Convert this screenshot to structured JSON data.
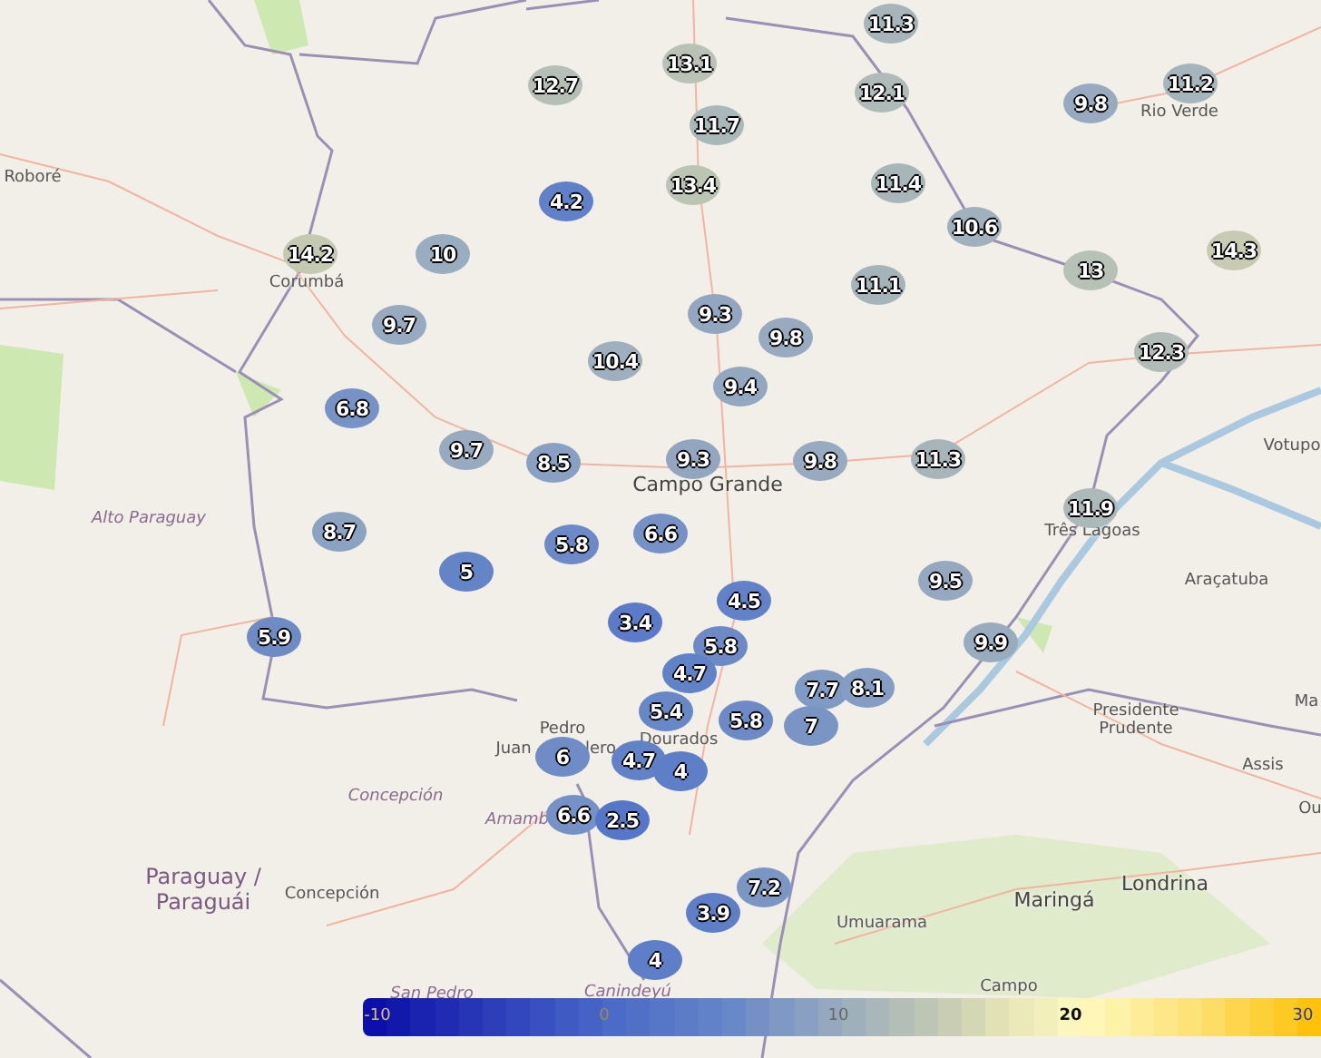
{
  "map_labels": [
    {
      "text": "Roboré",
      "kind": "town"
    },
    {
      "text": "Corumbá",
      "kind": "town"
    },
    {
      "text": "Alto Paraguay",
      "kind": "region"
    },
    {
      "text": "Campo Grande",
      "kind": "city"
    },
    {
      "text": "Rio Verde",
      "kind": "town"
    },
    {
      "text": "Votupo",
      "kind": "town"
    },
    {
      "text": "Três Lagoas",
      "kind": "town"
    },
    {
      "text": "Araçatuba",
      "kind": "town"
    },
    {
      "text": "Presidente",
      "kind": "town"
    },
    {
      "text": "Prudente",
      "kind": "town"
    },
    {
      "text": "Ma",
      "kind": "town"
    },
    {
      "text": "Assis",
      "kind": "town"
    },
    {
      "text": "Ou",
      "kind": "town"
    },
    {
      "text": "Londrina",
      "kind": "city"
    },
    {
      "text": "Maringá",
      "kind": "city"
    },
    {
      "text": "Umuarama",
      "kind": "town"
    },
    {
      "text": "Campo",
      "kind": "town"
    },
    {
      "text": "Pedro",
      "kind": "town"
    },
    {
      "text": "Juan",
      "kind": "town"
    },
    {
      "text": "lero",
      "kind": "town"
    },
    {
      "text": "Dourados",
      "kind": "town"
    },
    {
      "text": "Concepción",
      "kind": "region"
    },
    {
      "text": "Amamb",
      "kind": "region"
    },
    {
      "text": "Paraguay /",
      "kind": "country"
    },
    {
      "text": "Paraguái",
      "kind": "country"
    },
    {
      "text": "Concepción",
      "kind": "town"
    },
    {
      "text": "San Pedro",
      "kind": "region"
    },
    {
      "text": "Canindeyú",
      "kind": "region"
    }
  ],
  "markers": [
    {
      "value": "12.7"
    },
    {
      "value": "13.1"
    },
    {
      "value": "11.3"
    },
    {
      "value": "12.1"
    },
    {
      "value": "11.7"
    },
    {
      "value": "9.8"
    },
    {
      "value": "11.2"
    },
    {
      "value": "13.4"
    },
    {
      "value": "11.4"
    },
    {
      "value": "4.2"
    },
    {
      "value": "10.6"
    },
    {
      "value": "14.2"
    },
    {
      "value": "10"
    },
    {
      "value": "13"
    },
    {
      "value": "14.3"
    },
    {
      "value": "11.1"
    },
    {
      "value": "9.7"
    },
    {
      "value": "9.3"
    },
    {
      "value": "9.8"
    },
    {
      "value": "10.4"
    },
    {
      "value": "9.4"
    },
    {
      "value": "12.3"
    },
    {
      "value": "6.8"
    },
    {
      "value": "9.7"
    },
    {
      "value": "8.5"
    },
    {
      "value": "9.3"
    },
    {
      "value": "9.8"
    },
    {
      "value": "11.3"
    },
    {
      "value": "11.9"
    },
    {
      "value": "8.7"
    },
    {
      "value": "5.8"
    },
    {
      "value": "6.6"
    },
    {
      "value": "5"
    },
    {
      "value": "9.5"
    },
    {
      "value": "4.5"
    },
    {
      "value": "5.9"
    },
    {
      "value": "3.4"
    },
    {
      "value": "5.8"
    },
    {
      "value": "9.9"
    },
    {
      "value": "4.7"
    },
    {
      "value": "5.4"
    },
    {
      "value": "7.7"
    },
    {
      "value": "8.1"
    },
    {
      "value": "7"
    },
    {
      "value": "5.8"
    },
    {
      "value": "6"
    },
    {
      "value": "4.7"
    },
    {
      "value": "4"
    },
    {
      "value": "6.6"
    },
    {
      "value": "2.5"
    },
    {
      "value": "7.2"
    },
    {
      "value": "3.9"
    },
    {
      "value": "4"
    }
  ],
  "legend": {
    "ticks": [
      "-10",
      "0",
      "10",
      "20",
      "30"
    ]
  }
}
